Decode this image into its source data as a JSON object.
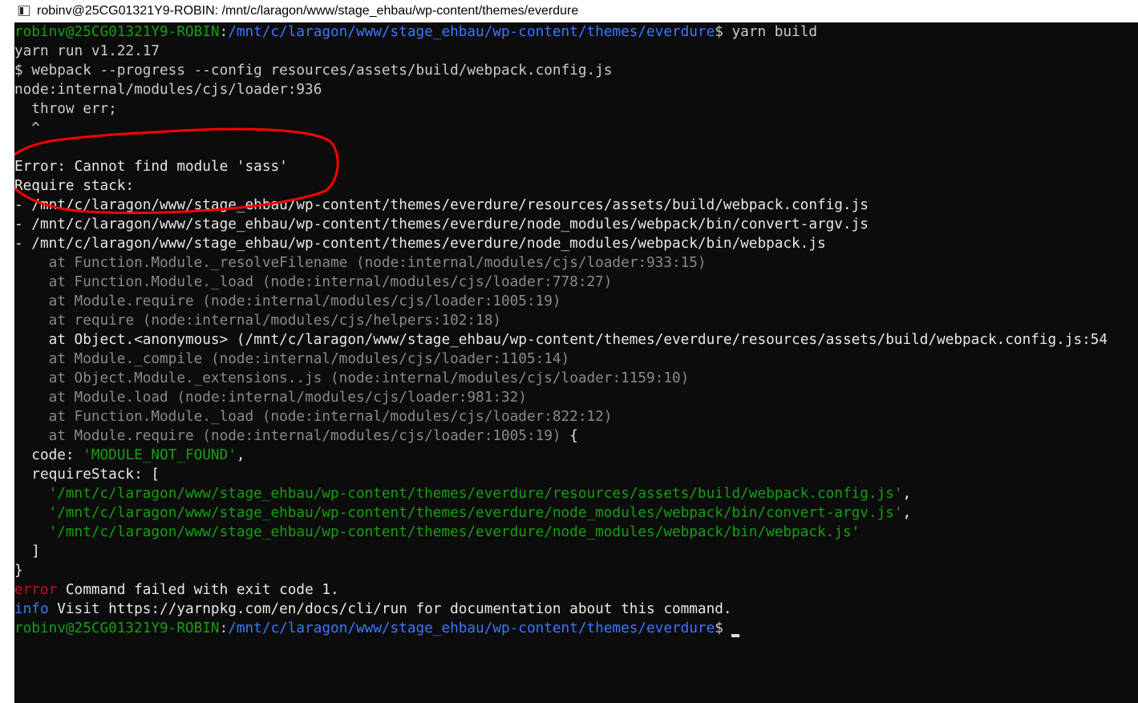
{
  "window": {
    "title": "robinv@25CG01321Y9-ROBIN: /mnt/c/laragon/www/stage_ehbau/wp-content/themes/everdure",
    "icon": "terminal-icon"
  },
  "colors": {
    "background": "#0c0c0c",
    "text": "#cccccc",
    "prompt_user": "#13a10e",
    "prompt_path": "#3b78ff",
    "error_label": "#c50f1f",
    "info_label": "#3b78ff",
    "string": "#13a10e",
    "stack_trace": "#8a8a8a",
    "annotation": "#ff0000"
  },
  "terminal": {
    "prompt": {
      "user_host": "robinv@25CG01321Y9-ROBIN",
      "separator": ":",
      "path": "/mnt/c/laragon/www/stage_ehbau/wp-content/themes/everdure",
      "symbol": "$ "
    },
    "command": "yarn build",
    "output": {
      "yarn_version": "yarn run v1.22.17",
      "webpack_cmd": "$ webpack --progress --config resources/assets/build/webpack.config.js",
      "loader_line": "node:internal/modules/cjs/loader:936",
      "throw_line": "  throw err;",
      "caret_line": "  ^",
      "error_message": "Error: Cannot find module 'sass'",
      "require_stack_label": "Require stack:",
      "require_stack": [
        "- /mnt/c/laragon/www/stage_ehbau/wp-content/themes/everdure/resources/assets/build/webpack.config.js",
        "- /mnt/c/laragon/www/stage_ehbau/wp-content/themes/everdure/node_modules/webpack/bin/convert-argv.js",
        "- /mnt/c/laragon/www/stage_ehbau/wp-content/themes/everdure/node_modules/webpack/bin/webpack.js"
      ],
      "trace_prefix": "    at ",
      "trace": [
        {
          "fn": "Function.Module._resolveFilename",
          "loc": "(node:internal/modules/cjs/loader:933:15)"
        },
        {
          "fn": "Function.Module._load",
          "loc": "(node:internal/modules/cjs/loader:778:27)"
        },
        {
          "fn": "Module.require",
          "loc": "(node:internal/modules/cjs/loader:1005:19)"
        },
        {
          "fn": "require",
          "loc": "(node:internal/modules/cjs/helpers:102:18)"
        },
        {
          "fn": "Object.<anonymous>",
          "loc": "(/mnt/c/laragon/www/stage_ehbau/wp-content/themes/everdure/resources/assets/build/webpack.config.js:54"
        },
        {
          "fn": "Module._compile",
          "loc": "(node:internal/modules/cjs/loader:1105:14)"
        },
        {
          "fn": "Object.Module._extensions..js",
          "loc": "(node:internal/modules/cjs/loader:1159:10)"
        },
        {
          "fn": "Module.load",
          "loc": "(node:internal/modules/cjs/loader:981:32)"
        },
        {
          "fn": "Function.Module._load",
          "loc": "(node:internal/modules/cjs/loader:822:12)"
        },
        {
          "fn": "Module.require",
          "loc": "(node:internal/modules/cjs/loader:1005:19)"
        }
      ],
      "trace_last_suffix": " {",
      "code_key": "  code: ",
      "code_value": "'MODULE_NOT_FOUND'",
      "code_comma": ",",
      "require_stack_key": "  requireStack: [",
      "require_stack_strings": [
        "'/mnt/c/laragon/www/stage_ehbau/wp-content/themes/everdure/resources/assets/build/webpack.config.js'",
        "'/mnt/c/laragon/www/stage_ehbau/wp-content/themes/everdure/node_modules/webpack/bin/convert-argv.js'",
        "'/mnt/c/laragon/www/stage_ehbau/wp-content/themes/everdure/node_modules/webpack/bin/webpack.js'"
      ],
      "array_comma": ",",
      "array_close": "  ]",
      "object_close": "}",
      "error_label": "error",
      "error_text": " Command failed with exit code 1.",
      "info_label": "info",
      "info_text": " Visit https://yarnpkg.com/en/docs/cli/run for documentation about this command."
    }
  }
}
